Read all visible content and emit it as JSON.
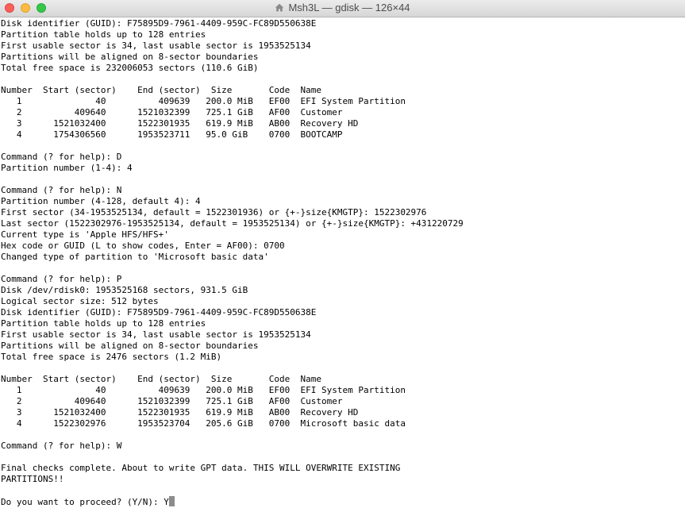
{
  "window": {
    "title": "Msh3L — gdisk — 126×44"
  },
  "terminal": {
    "lines": [
      "Disk identifier (GUID): F75895D9-7961-4409-959C-FC89D550638E",
      "Partition table holds up to 128 entries",
      "First usable sector is 34, last usable sector is 1953525134",
      "Partitions will be aligned on 8-sector boundaries",
      "Total free space is 232006053 sectors (110.6 GiB)",
      "",
      "Number  Start (sector)    End (sector)  Size       Code  Name",
      "   1              40          409639   200.0 MiB   EF00  EFI System Partition",
      "   2          409640      1521032399   725.1 GiB   AF00  Customer",
      "   3      1521032400      1522301935   619.9 MiB   AB00  Recovery HD",
      "   4      1754306560      1953523711   95.0 GiB    0700  BOOTCAMP",
      "",
      "Command (? for help): D",
      "Partition number (1-4): 4",
      "",
      "Command (? for help): N",
      "Partition number (4-128, default 4): 4",
      "First sector (34-1953525134, default = 1522301936) or {+-}size{KMGTP}: 1522302976",
      "Last sector (1522302976-1953525134, default = 1953525134) or {+-}size{KMGTP}: +431220729",
      "Current type is 'Apple HFS/HFS+'",
      "Hex code or GUID (L to show codes, Enter = AF00): 0700",
      "Changed type of partition to 'Microsoft basic data'",
      "",
      "Command (? for help): P",
      "Disk /dev/rdisk0: 1953525168 sectors, 931.5 GiB",
      "Logical sector size: 512 bytes",
      "Disk identifier (GUID): F75895D9-7961-4409-959C-FC89D550638E",
      "Partition table holds up to 128 entries",
      "First usable sector is 34, last usable sector is 1953525134",
      "Partitions will be aligned on 8-sector boundaries",
      "Total free space is 2476 sectors (1.2 MiB)",
      "",
      "Number  Start (sector)    End (sector)  Size       Code  Name",
      "   1              40          409639   200.0 MiB   EF00  EFI System Partition",
      "   2          409640      1521032399   725.1 GiB   AF00  Customer",
      "   3      1521032400      1522301935   619.9 MiB   AB00  Recovery HD",
      "   4      1522302976      1953523704   205.6 GiB   0700  Microsoft basic data",
      "",
      "Command (? for help): W",
      "",
      "Final checks complete. About to write GPT data. THIS WILL OVERWRITE EXISTING",
      "PARTITIONS!!",
      ""
    ],
    "prompt": "Do you want to proceed? (Y/N): Y"
  }
}
